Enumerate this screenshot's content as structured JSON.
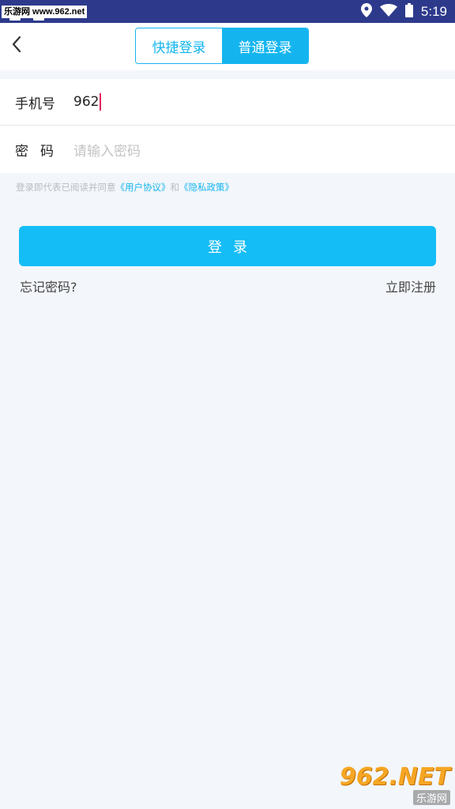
{
  "status_bar": {
    "watermark": "乐游网 www.962.net",
    "time": "5:19",
    "location_icon": "location-icon",
    "wifi_icon": "wifi-icon",
    "battery_icon": "battery-icon"
  },
  "header": {
    "back_icon": "chevron-left-icon",
    "tabs": [
      {
        "label": "快捷登录",
        "active": false
      },
      {
        "label": "普通登录",
        "active": true
      }
    ]
  },
  "form": {
    "phone": {
      "label": "手机号",
      "value": "962"
    },
    "password": {
      "label": "密码",
      "placeholder": "请输入密码"
    }
  },
  "agreement": {
    "prefix": "登录即代表已阅读并同意",
    "user_agreement": "《用户协议》",
    "and": "和",
    "privacy_policy": "《隐私政策》"
  },
  "login_button": "登录",
  "forgot_password": "忘记密码?",
  "register": "立即注册",
  "watermark_bottom": {
    "number": "962.NET",
    "sub": "乐游网"
  },
  "colors": {
    "accent": "#14b5ef",
    "status_bar": "#2d3a8c",
    "background": "#f3f6fa",
    "caret": "#e0245e"
  }
}
